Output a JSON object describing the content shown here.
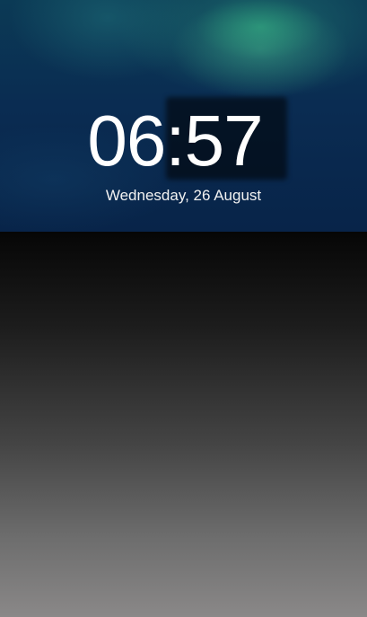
{
  "lockscreen": {
    "time": "06:57",
    "date": "Wednesday, 26 August"
  },
  "colors": {
    "wallpaper_top": "#0b3a55",
    "wallpaper_bottom": "#082449",
    "aurora": "#2f9677",
    "panel_top": "#060606",
    "panel_bottom": "#8a8888",
    "text": "#ffffff"
  }
}
